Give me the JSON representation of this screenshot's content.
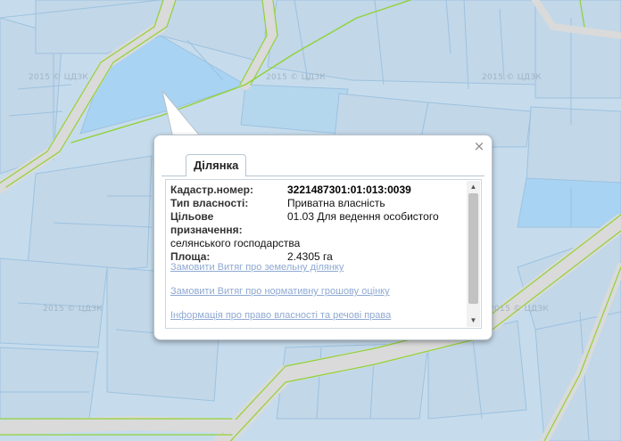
{
  "map": {
    "watermark": "2015 © ЦДЗК",
    "colors": {
      "background": "#c6dcec",
      "parcel_fill": "#c2d7e8",
      "parcel_highlight": "#a9d3f2",
      "parcel_border": "#9dc2e0",
      "road": "#dadada",
      "road_edge": "#90d236"
    }
  },
  "popup": {
    "tab_label": "Ділянка",
    "close_icon": "×",
    "fields": [
      {
        "label": "Кадастр.номер:",
        "value": "3221487301:01:013:0039"
      },
      {
        "label": "Тип власності:",
        "value": "Приватна власність"
      },
      {
        "label": "Цільове призначення:",
        "value": "01.03 Для ведення особистого"
      },
      {
        "label": "",
        "value": "селянського господарства"
      },
      {
        "label": "Площа:",
        "value": "2.4305 га"
      }
    ],
    "links": [
      "Замовити Витяг про земельну ділянку",
      "Замовити Витяг про нормативну грошову оцінку",
      "Інформація про право власності та речові права"
    ],
    "scroll_up_icon": "▲",
    "scroll_down_icon": "▼"
  }
}
